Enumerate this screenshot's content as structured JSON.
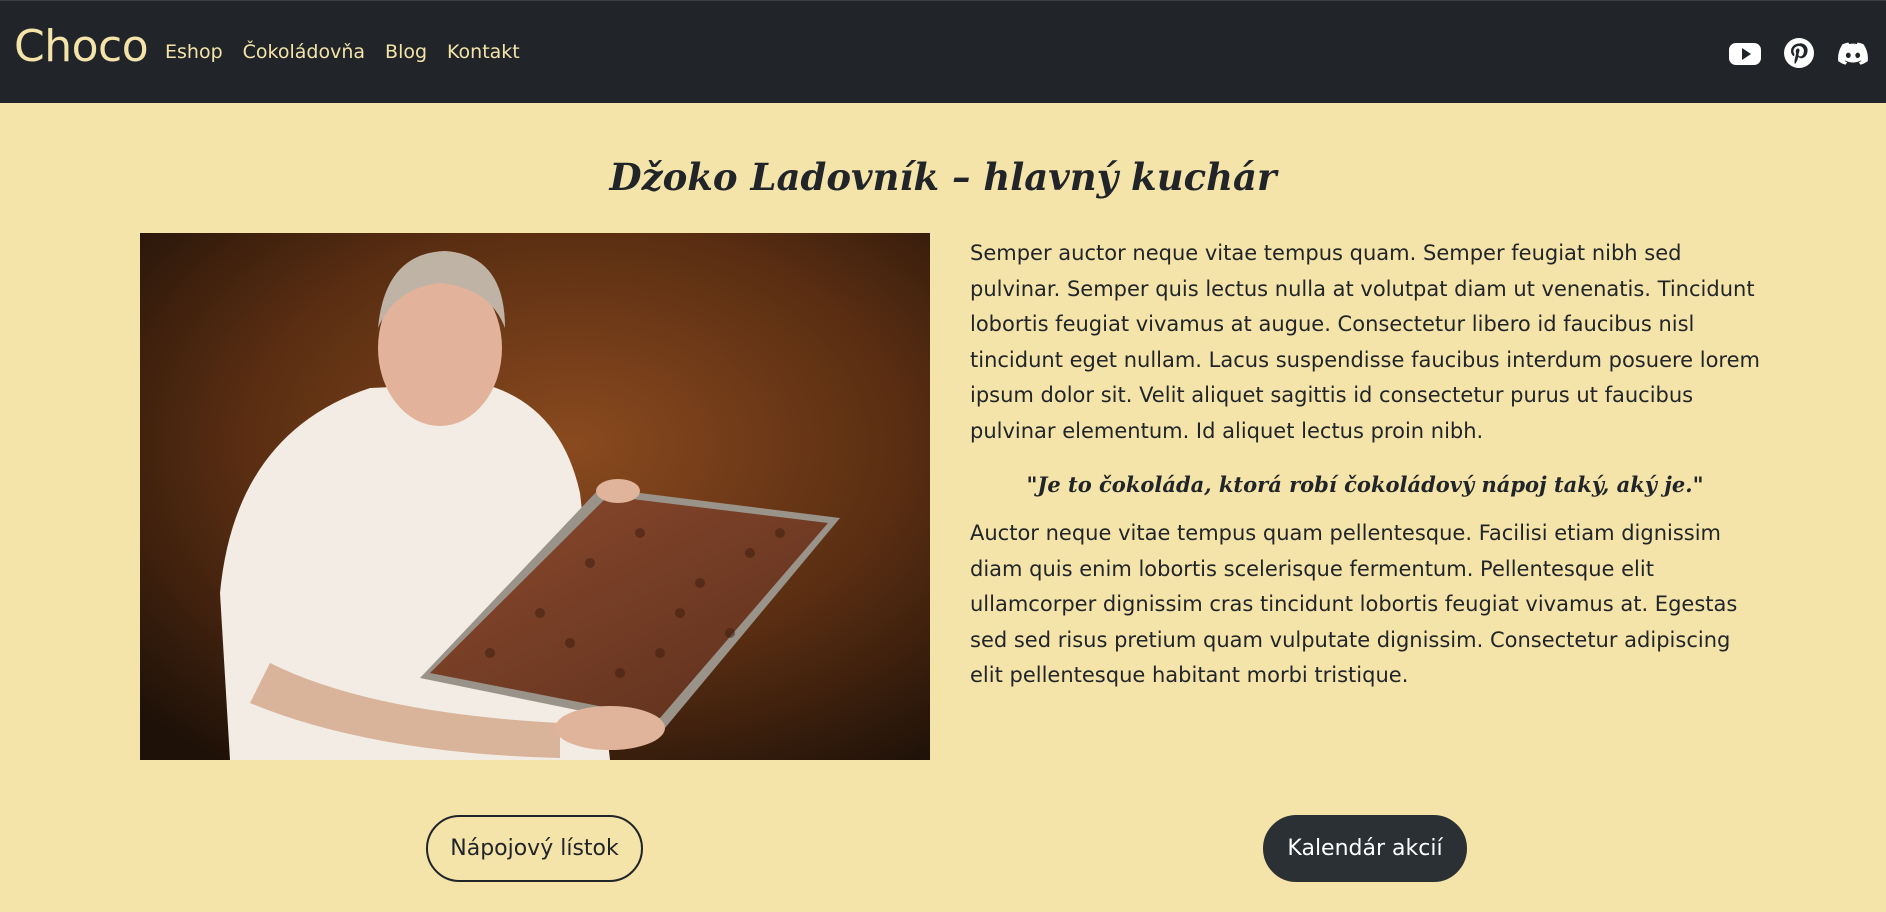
{
  "nav": {
    "brand": "Choco",
    "links": [
      "Eshop",
      "Čokoládovňa",
      "Blog",
      "Kontakt"
    ],
    "social": [
      "youtube-icon",
      "pinterest-icon",
      "discord-icon"
    ]
  },
  "main": {
    "title": "Džoko Ladovník – hlavný kuchár",
    "paragraph1": "Semper auctor neque vitae tempus quam. Semper feugiat nibh sed pulvinar. Semper quis lectus nulla at volutpat diam ut venenatis. Tincidunt lobortis feugiat vivamus at augue. Consectetur libero id faucibus nisl tincidunt eget nullam. Lacus suspendisse faucibus interdum posuere lorem ipsum dolor sit. Velit aliquet sagittis id consectetur purus ut faucibus pulvinar elementum. Id aliquet lectus proin nibh.",
    "quote": "\"Je to čokoláda, ktorá robí čokoládový nápoj taký, aký je.\"",
    "paragraph2": "Auctor neque vitae tempus quam pellentesque. Facilisi etiam dignissim diam quis enim lobortis scelerisque fermentum. Pellentesque elit ullamcorper dignissim cras tincidunt lobortis feugiat vivamus at. Egestas sed sed risus pretium quam vulputate dignissim. Consectetur adipiscing elit pellentesque habitant morbi tristique."
  },
  "buttons": {
    "menu": "Nápojový lístok",
    "calendar": "Kalendár akcií"
  },
  "colors": {
    "navbar": "#212529",
    "background": "#f4e4a9",
    "accent": "#f4e4a9",
    "text": "#212529"
  }
}
